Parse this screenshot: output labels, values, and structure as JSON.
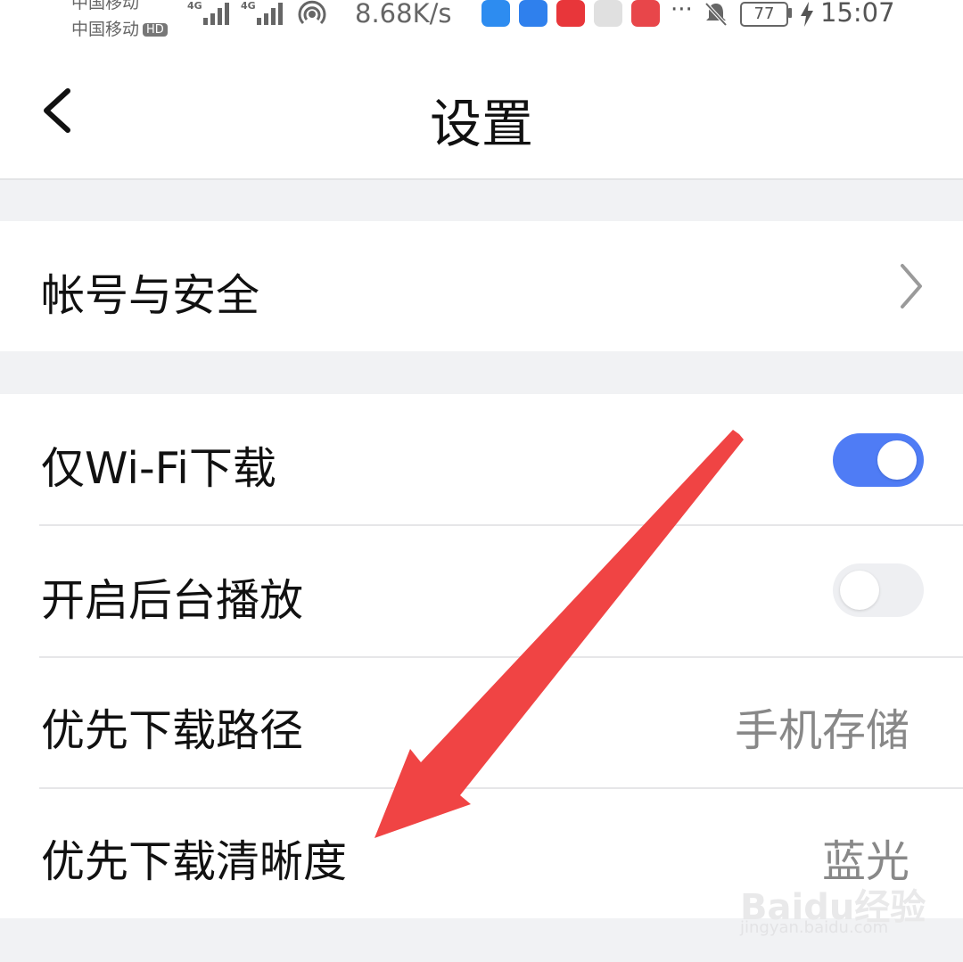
{
  "status_bar": {
    "carrier1": "中国移动",
    "carrier2": "中国移动",
    "hd": "HD",
    "network1": "4G",
    "network2": "4G",
    "speed": "8.68K/s",
    "battery": "77",
    "time": "15:07",
    "dots": "···",
    "icons": [
      "signal-icon",
      "signal-icon",
      "hotspot-icon",
      "search-app-icon",
      "weather-app-icon",
      "huawei-store-icon",
      "gift-app-icon",
      "reader-app-icon",
      "mute-bell-icon",
      "battery-icon",
      "charging-icon"
    ]
  },
  "header": {
    "title": "设置"
  },
  "account": {
    "label": "帐号与安全"
  },
  "settings": {
    "wifi_only": {
      "label": "仅Wi-Fi下载",
      "on": true
    },
    "background_play": {
      "label": "开启后台播放",
      "on": false
    },
    "download_path": {
      "label": "优先下载路径",
      "value": "手机存储"
    },
    "download_quality": {
      "label": "优先下载清晰度",
      "value": "蓝光"
    }
  },
  "watermark": {
    "brand": "Baidu经验",
    "url": "jingyan.baidu.com"
  },
  "colors": {
    "toggle_on": "#4f7cf5",
    "toggle_off": "#eeeff2",
    "annotation_arrow": "#f04444"
  }
}
